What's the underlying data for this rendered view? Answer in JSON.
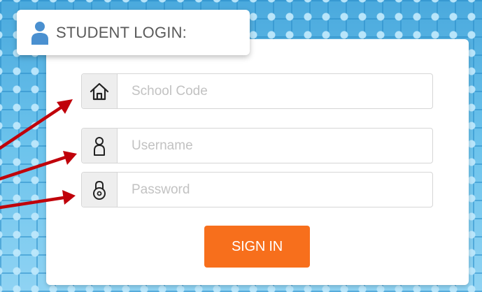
{
  "header": {
    "title": "STUDENT LOGIN:",
    "icon": "person-icon"
  },
  "form": {
    "school_code": {
      "placeholder": "School Code",
      "value": "",
      "icon": "house-icon"
    },
    "username": {
      "placeholder": "Username",
      "value": "",
      "icon": "person-outline-icon"
    },
    "password": {
      "placeholder": "Password",
      "value": "",
      "icon": "lock-icon"
    },
    "sign_in_label": "SIGN IN"
  },
  "colors": {
    "accent": "#f76f1c",
    "header_icon": "#4a90d0",
    "arrow": "#c0000a",
    "background": "#54b3e3"
  },
  "annotations": {
    "arrow_count": 3,
    "arrow_icon": "red-arrow-icon"
  }
}
